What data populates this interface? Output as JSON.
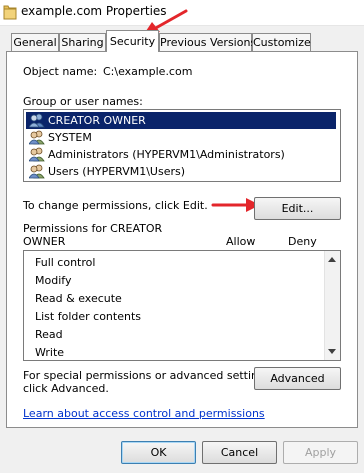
{
  "window": {
    "title": "example.com Properties"
  },
  "tabs": [
    {
      "label": "General"
    },
    {
      "label": "Sharing"
    },
    {
      "label": "Security",
      "selected": true
    },
    {
      "label": "Previous Versions"
    },
    {
      "label": "Customize"
    }
  ],
  "security": {
    "object_name_label": "Object name:",
    "object_name_value": "C:\\example.com",
    "group_label": "Group or user names:",
    "groups": [
      {
        "name": "CREATOR OWNER",
        "selected": true,
        "icon": "user-group-icon"
      },
      {
        "name": "SYSTEM",
        "icon": "user-group-icon"
      },
      {
        "name": "Administrators (HYPERVM1\\Administrators)",
        "icon": "user-group-icon"
      },
      {
        "name": "Users (HYPERVM1\\Users)",
        "icon": "user-group-icon"
      }
    ],
    "change_hint": "To change permissions, click Edit.",
    "edit_button": "Edit...",
    "permissions_label_line1": "Permissions for CREATOR",
    "permissions_label_line2": "OWNER",
    "allow_header": "Allow",
    "deny_header": "Deny",
    "permissions": [
      {
        "name": "Full control"
      },
      {
        "name": "Modify"
      },
      {
        "name": "Read & execute"
      },
      {
        "name": "List folder contents"
      },
      {
        "name": "Read"
      },
      {
        "name": "Write"
      }
    ],
    "special_hint_line1": "For special permissions or advanced settings,",
    "special_hint_line2": "click Advanced.",
    "advanced_button": "Advanced",
    "learn_link": "Learn about access control and permissions"
  },
  "footer": {
    "ok": "OK",
    "cancel": "Cancel",
    "apply": "Apply"
  },
  "colors": {
    "selection": "#0a246a",
    "annotation_arrow": "#e3262b",
    "link": "#0033cc"
  }
}
